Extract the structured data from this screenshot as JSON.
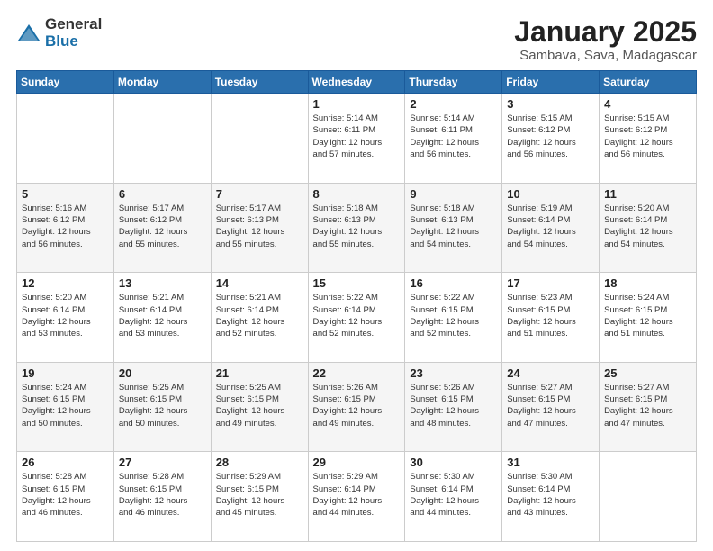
{
  "logo": {
    "general": "General",
    "blue": "Blue"
  },
  "title": {
    "month_year": "January 2025",
    "location": "Sambava, Sava, Madagascar"
  },
  "weekdays": [
    "Sunday",
    "Monday",
    "Tuesday",
    "Wednesday",
    "Thursday",
    "Friday",
    "Saturday"
  ],
  "weeks": [
    [
      {
        "day": "",
        "info": ""
      },
      {
        "day": "",
        "info": ""
      },
      {
        "day": "",
        "info": ""
      },
      {
        "day": "1",
        "info": "Sunrise: 5:14 AM\nSunset: 6:11 PM\nDaylight: 12 hours\nand 57 minutes."
      },
      {
        "day": "2",
        "info": "Sunrise: 5:14 AM\nSunset: 6:11 PM\nDaylight: 12 hours\nand 56 minutes."
      },
      {
        "day": "3",
        "info": "Sunrise: 5:15 AM\nSunset: 6:12 PM\nDaylight: 12 hours\nand 56 minutes."
      },
      {
        "day": "4",
        "info": "Sunrise: 5:15 AM\nSunset: 6:12 PM\nDaylight: 12 hours\nand 56 minutes."
      }
    ],
    [
      {
        "day": "5",
        "info": "Sunrise: 5:16 AM\nSunset: 6:12 PM\nDaylight: 12 hours\nand 56 minutes."
      },
      {
        "day": "6",
        "info": "Sunrise: 5:17 AM\nSunset: 6:12 PM\nDaylight: 12 hours\nand 55 minutes."
      },
      {
        "day": "7",
        "info": "Sunrise: 5:17 AM\nSunset: 6:13 PM\nDaylight: 12 hours\nand 55 minutes."
      },
      {
        "day": "8",
        "info": "Sunrise: 5:18 AM\nSunset: 6:13 PM\nDaylight: 12 hours\nand 55 minutes."
      },
      {
        "day": "9",
        "info": "Sunrise: 5:18 AM\nSunset: 6:13 PM\nDaylight: 12 hours\nand 54 minutes."
      },
      {
        "day": "10",
        "info": "Sunrise: 5:19 AM\nSunset: 6:14 PM\nDaylight: 12 hours\nand 54 minutes."
      },
      {
        "day": "11",
        "info": "Sunrise: 5:20 AM\nSunset: 6:14 PM\nDaylight: 12 hours\nand 54 minutes."
      }
    ],
    [
      {
        "day": "12",
        "info": "Sunrise: 5:20 AM\nSunset: 6:14 PM\nDaylight: 12 hours\nand 53 minutes."
      },
      {
        "day": "13",
        "info": "Sunrise: 5:21 AM\nSunset: 6:14 PM\nDaylight: 12 hours\nand 53 minutes."
      },
      {
        "day": "14",
        "info": "Sunrise: 5:21 AM\nSunset: 6:14 PM\nDaylight: 12 hours\nand 52 minutes."
      },
      {
        "day": "15",
        "info": "Sunrise: 5:22 AM\nSunset: 6:14 PM\nDaylight: 12 hours\nand 52 minutes."
      },
      {
        "day": "16",
        "info": "Sunrise: 5:22 AM\nSunset: 6:15 PM\nDaylight: 12 hours\nand 52 minutes."
      },
      {
        "day": "17",
        "info": "Sunrise: 5:23 AM\nSunset: 6:15 PM\nDaylight: 12 hours\nand 51 minutes."
      },
      {
        "day": "18",
        "info": "Sunrise: 5:24 AM\nSunset: 6:15 PM\nDaylight: 12 hours\nand 51 minutes."
      }
    ],
    [
      {
        "day": "19",
        "info": "Sunrise: 5:24 AM\nSunset: 6:15 PM\nDaylight: 12 hours\nand 50 minutes."
      },
      {
        "day": "20",
        "info": "Sunrise: 5:25 AM\nSunset: 6:15 PM\nDaylight: 12 hours\nand 50 minutes."
      },
      {
        "day": "21",
        "info": "Sunrise: 5:25 AM\nSunset: 6:15 PM\nDaylight: 12 hours\nand 49 minutes."
      },
      {
        "day": "22",
        "info": "Sunrise: 5:26 AM\nSunset: 6:15 PM\nDaylight: 12 hours\nand 49 minutes."
      },
      {
        "day": "23",
        "info": "Sunrise: 5:26 AM\nSunset: 6:15 PM\nDaylight: 12 hours\nand 48 minutes."
      },
      {
        "day": "24",
        "info": "Sunrise: 5:27 AM\nSunset: 6:15 PM\nDaylight: 12 hours\nand 47 minutes."
      },
      {
        "day": "25",
        "info": "Sunrise: 5:27 AM\nSunset: 6:15 PM\nDaylight: 12 hours\nand 47 minutes."
      }
    ],
    [
      {
        "day": "26",
        "info": "Sunrise: 5:28 AM\nSunset: 6:15 PM\nDaylight: 12 hours\nand 46 minutes."
      },
      {
        "day": "27",
        "info": "Sunrise: 5:28 AM\nSunset: 6:15 PM\nDaylight: 12 hours\nand 46 minutes."
      },
      {
        "day": "28",
        "info": "Sunrise: 5:29 AM\nSunset: 6:15 PM\nDaylight: 12 hours\nand 45 minutes."
      },
      {
        "day": "29",
        "info": "Sunrise: 5:29 AM\nSunset: 6:14 PM\nDaylight: 12 hours\nand 44 minutes."
      },
      {
        "day": "30",
        "info": "Sunrise: 5:30 AM\nSunset: 6:14 PM\nDaylight: 12 hours\nand 44 minutes."
      },
      {
        "day": "31",
        "info": "Sunrise: 5:30 AM\nSunset: 6:14 PM\nDaylight: 12 hours\nand 43 minutes."
      },
      {
        "day": "",
        "info": ""
      }
    ]
  ]
}
